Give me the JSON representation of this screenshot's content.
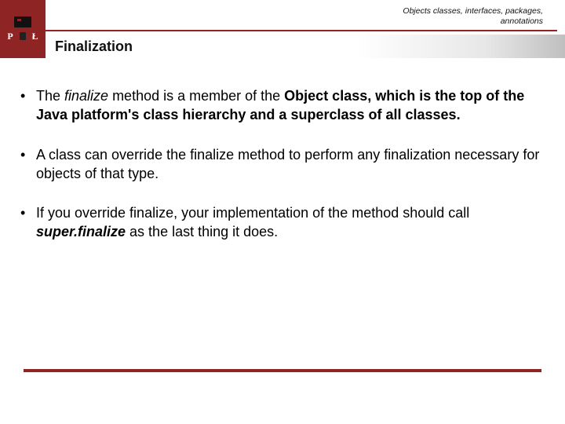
{
  "header": {
    "caption_line1": "Objects classes, interfaces, packages,",
    "caption_line2": "annotations",
    "logo_letter_left": "P",
    "logo_letter_right": "Ł"
  },
  "title": "Finalization",
  "bullets": [
    {
      "pre": "The ",
      "em": "finalize",
      "post": " method is a member of the ",
      "bold": "Object class, which is the top of the Java platform's class hierarchy and a superclass of all classes."
    },
    {
      "text": "A class can override the finalize method to perform any finalization necessary for objects of that type."
    },
    {
      "pre": " If you override finalize, your implementation of the method should call ",
      "em_bi": "super.finalize",
      "post": " as the last thing it does."
    }
  ]
}
